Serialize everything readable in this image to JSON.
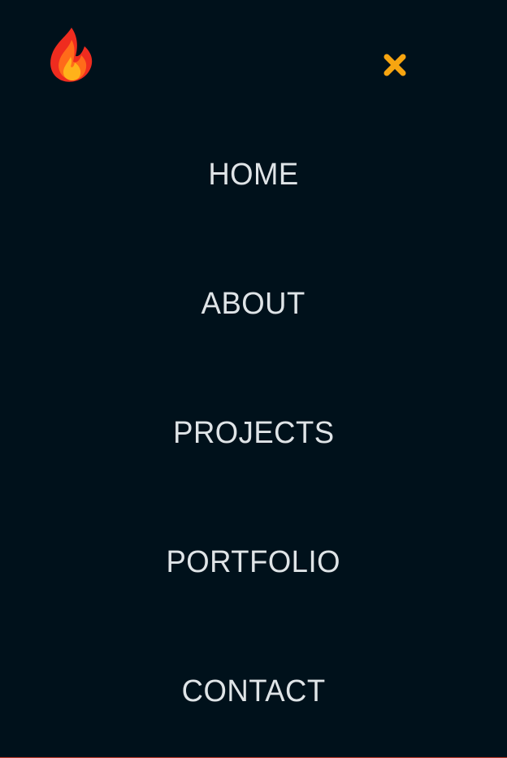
{
  "brand": {
    "logo_icon": "fire-icon",
    "logo_colors": {
      "outer": "#ef2c1f",
      "middle": "#ff6b1a",
      "inner": "#ffb21a"
    }
  },
  "header": {
    "close_icon": "close-icon",
    "close_color": "#f7a510"
  },
  "navigation": {
    "items": [
      {
        "label": "HOME"
      },
      {
        "label": "ABOUT"
      },
      {
        "label": "PROJECTS"
      },
      {
        "label": "PORTFOLIO"
      },
      {
        "label": "CONTACT"
      }
    ]
  },
  "theme": {
    "background": "#00111b",
    "text": "#dfe4e7"
  }
}
